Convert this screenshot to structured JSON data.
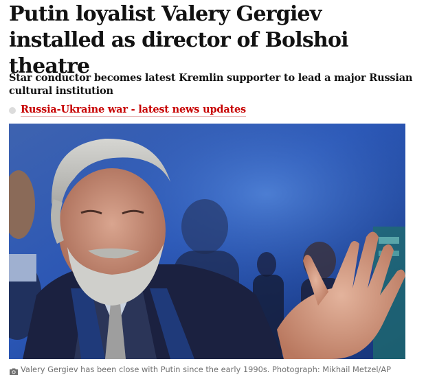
{
  "article": {
    "headline": "Putin loyalist Valery Gergiev installed as director of Bolshoi theatre",
    "standfirst": "Star conductor becomes latest Kremlin supporter to lead a major Russian cultural institution",
    "live_link_label": "Russia-Ukraine war - latest news updates",
    "image": {
      "caption": "Valery Gergiev has been close with Putin since the early 1990s. Photograph: Mikhail Metzel/AP"
    }
  },
  "colors": {
    "headline": "#121212",
    "link": "#c70000",
    "caption": "#707070",
    "photo_background": "#1e3f88"
  },
  "icons": {
    "live_indicator": "live-dot-icon",
    "caption_prefix": "camera-icon"
  }
}
